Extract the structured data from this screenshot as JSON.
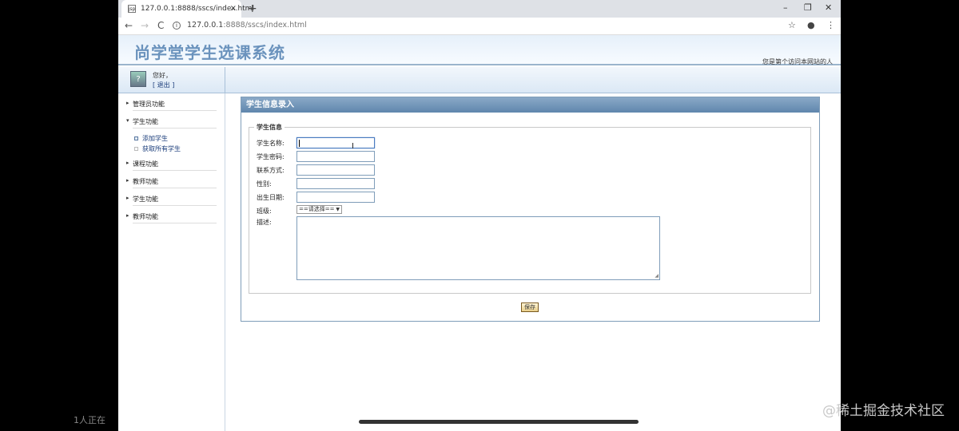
{
  "browser": {
    "tab_title": "127.0.0.1:8888/sscs/index.html",
    "tab_favicon": "jsp",
    "tab_close": "×",
    "new_tab": "+",
    "minimize": "–",
    "restore": "❐",
    "close": "✕",
    "back": "←",
    "forward": "→",
    "reload": "C",
    "url_host": "127.0.0.1",
    "url_rest": ":8888/sscs/index.html",
    "star": "☆",
    "profile": "●",
    "menu": "⋮"
  },
  "header": {
    "site_title": "尚学堂学生选课系统",
    "visitor_text": "您是第个访问本网站的人"
  },
  "user": {
    "greeting": "您好，",
    "logout": "[ 退出 ]"
  },
  "sidebar": {
    "items": [
      {
        "label": "管理员功能",
        "expanded": false
      },
      {
        "label": "学生功能",
        "expanded": true
      },
      {
        "label": "课程功能",
        "expanded": false
      },
      {
        "label": "教师功能",
        "expanded": false
      },
      {
        "label": "学生功能",
        "expanded": false
      },
      {
        "label": "教师功能",
        "expanded": false
      }
    ],
    "subitems": [
      {
        "label": "添加学生"
      },
      {
        "label": "获取所有学生"
      }
    ]
  },
  "form": {
    "panel_title": "学生信息录入",
    "legend": "学生信息",
    "fields": [
      {
        "label": "学生名称:",
        "value": ""
      },
      {
        "label": "学生密码:",
        "value": ""
      },
      {
        "label": "联系方式:",
        "value": ""
      },
      {
        "label": "性别:",
        "value": ""
      },
      {
        "label": "出生日期:",
        "value": ""
      }
    ],
    "class_label": "班级:",
    "class_selected": "==请选择==",
    "desc_label": "描述:",
    "save_label": "保存"
  },
  "overlay": {
    "watermark": "@稀土掘金技术社区",
    "viewers": "1人正在"
  },
  "colors": {
    "title_blue": "#6b93bd",
    "panel_header": "#6f94b8",
    "border": "#7f9db9"
  }
}
